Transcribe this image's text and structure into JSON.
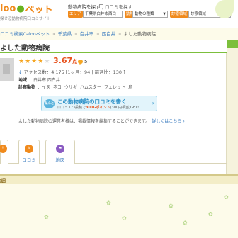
{
  "header": {
    "logo_text": "loo",
    "logo_suffix": "ペット",
    "tagline": "探せる動物病院口コミサイト",
    "search_label": "動物病院を探す",
    "search_sep": "|",
    "review_check_label": "口コミを探す",
    "area_tag": "エリア",
    "area_value": "千葉県白井市西白",
    "animal_tag": "動物",
    "animal_value": "動物の種類",
    "field_tag": "診療領域",
    "field_value": "診察領域"
  },
  "breadcrumb": [
    "ロコミ検索Calooペット",
    "千葉県",
    "白井市",
    "西白井",
    "よした動物病院"
  ],
  "hospital": {
    "name": "よした動物病院",
    "rating": "3.67",
    "rating_unit": "点",
    "rating_value": 3.67,
    "comment_count": "5",
    "access_text": "アクセス数：4,175 [1ヶ月：94 | 前週比：130 ]",
    "location_label": "地域",
    "location_value": "：白井市 西白井",
    "animals_label": "診察動物",
    "animals": [
      "：イヌ",
      "ネコ",
      "ウサギ",
      "ハムスター",
      "フェレット",
      "鳥"
    ]
  },
  "cta": {
    "badge": "なんと",
    "title": "この動物病院の口コミを書く",
    "sub_prefix": "ロコミ１つ投稿で",
    "sub_points": "300Gポイント",
    "sub_suffix": "(300円相当)GET!"
  },
  "admin_note": {
    "text": "よした動物病院の運営者様は、掲載情報を編集することができます。",
    "link": "詳しくはこちら ›"
  },
  "tabs": [
    {
      "label": "",
      "icon": "!"
    },
    {
      "label": "ロコミ",
      "icon": "✎"
    },
    {
      "label": "地図",
      "icon": "⚑"
    }
  ],
  "detail": {
    "label": "細"
  }
}
